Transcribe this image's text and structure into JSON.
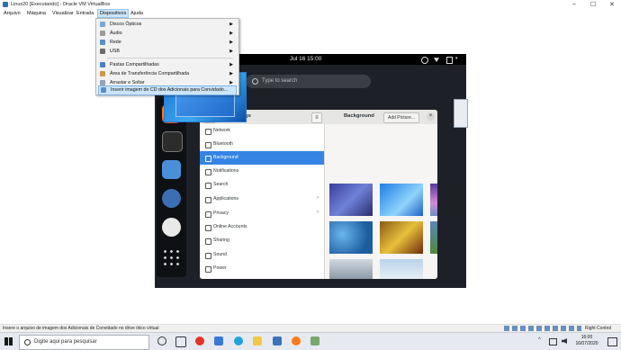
{
  "window": {
    "title": "Linux20 [Executando] - Oracle VM VirtualBox",
    "controls": {
      "minimize": "–",
      "maximize": "☐",
      "close": "✕"
    }
  },
  "menubar": {
    "items": [
      "Arquivo",
      "Máquina",
      "Visualizar",
      "Entrada",
      "Dispositivos",
      "Ajuda"
    ],
    "active": "Dispositivos"
  },
  "devices_menu": {
    "items": [
      {
        "label": "Discos Ópticos",
        "icon": "optical-disc-icon",
        "submenu": true
      },
      {
        "label": "Áudio",
        "icon": "audio-icon",
        "submenu": true
      },
      {
        "label": "Rede",
        "icon": "network-icon",
        "submenu": true
      },
      {
        "label": "USB",
        "icon": "usb-icon",
        "submenu": true
      },
      {
        "label": "Pastas Compartilhadas",
        "icon": "shared-folder-icon",
        "submenu": true
      },
      {
        "label": "Área de Transferência Compartilhada",
        "icon": "clipboard-icon",
        "submenu": true
      },
      {
        "label": "Arrastar e Soltar",
        "icon": "drag-drop-icon",
        "submenu": true
      },
      {
        "label": "Inserir imagem de CD dos Adicionais para Convidado...",
        "icon": "guest-additions-cd-icon",
        "submenu": false
      }
    ],
    "highlighted": "Inserir imagem de CD dos Adicionais para Convidado..."
  },
  "guest": {
    "clock": "Jul 16  15:00",
    "search_placeholder": "Type to search",
    "dash_apps": [
      "firefox-icon",
      "rhythmbox-icon",
      "files-icon",
      "fedora-icon",
      "settings-gear-icon",
      "app-grid-icon"
    ],
    "settings": {
      "title": "Settings",
      "panel_title": "Background",
      "add_picture": "Add Picture...",
      "sidebar": [
        {
          "label": "Network",
          "icon": "network-icon",
          "arrow": false
        },
        {
          "label": "Bluetooth",
          "icon": "bluetooth-icon",
          "arrow": false
        },
        {
          "label": "Background",
          "icon": "background-icon",
          "arrow": false
        },
        {
          "label": "Notifications",
          "icon": "notifications-icon",
          "arrow": false
        },
        {
          "label": "Search",
          "icon": "search-icon",
          "arrow": false
        },
        {
          "label": "Applications",
          "icon": "applications-icon",
          "arrow": true
        },
        {
          "label": "Privacy",
          "icon": "privacy-icon",
          "arrow": true
        },
        {
          "label": "Online Accounts",
          "icon": "online-accounts-icon",
          "arrow": false
        },
        {
          "label": "Sharing",
          "icon": "sharing-icon",
          "arrow": false
        },
        {
          "label": "Sound",
          "icon": "sound-icon",
          "arrow": false
        },
        {
          "label": "Power",
          "icon": "power-icon",
          "arrow": false
        }
      ],
      "selected": "Background"
    }
  },
  "status_bar": {
    "text": "Insere o arquivo de imagem dos Adicionais de Convidado no drive ótico virtual",
    "host_key": "Right Control"
  },
  "taskbar": {
    "search_placeholder": "Digite aqui para pesquisar",
    "time": "16:00",
    "date": "16/07/2020"
  }
}
